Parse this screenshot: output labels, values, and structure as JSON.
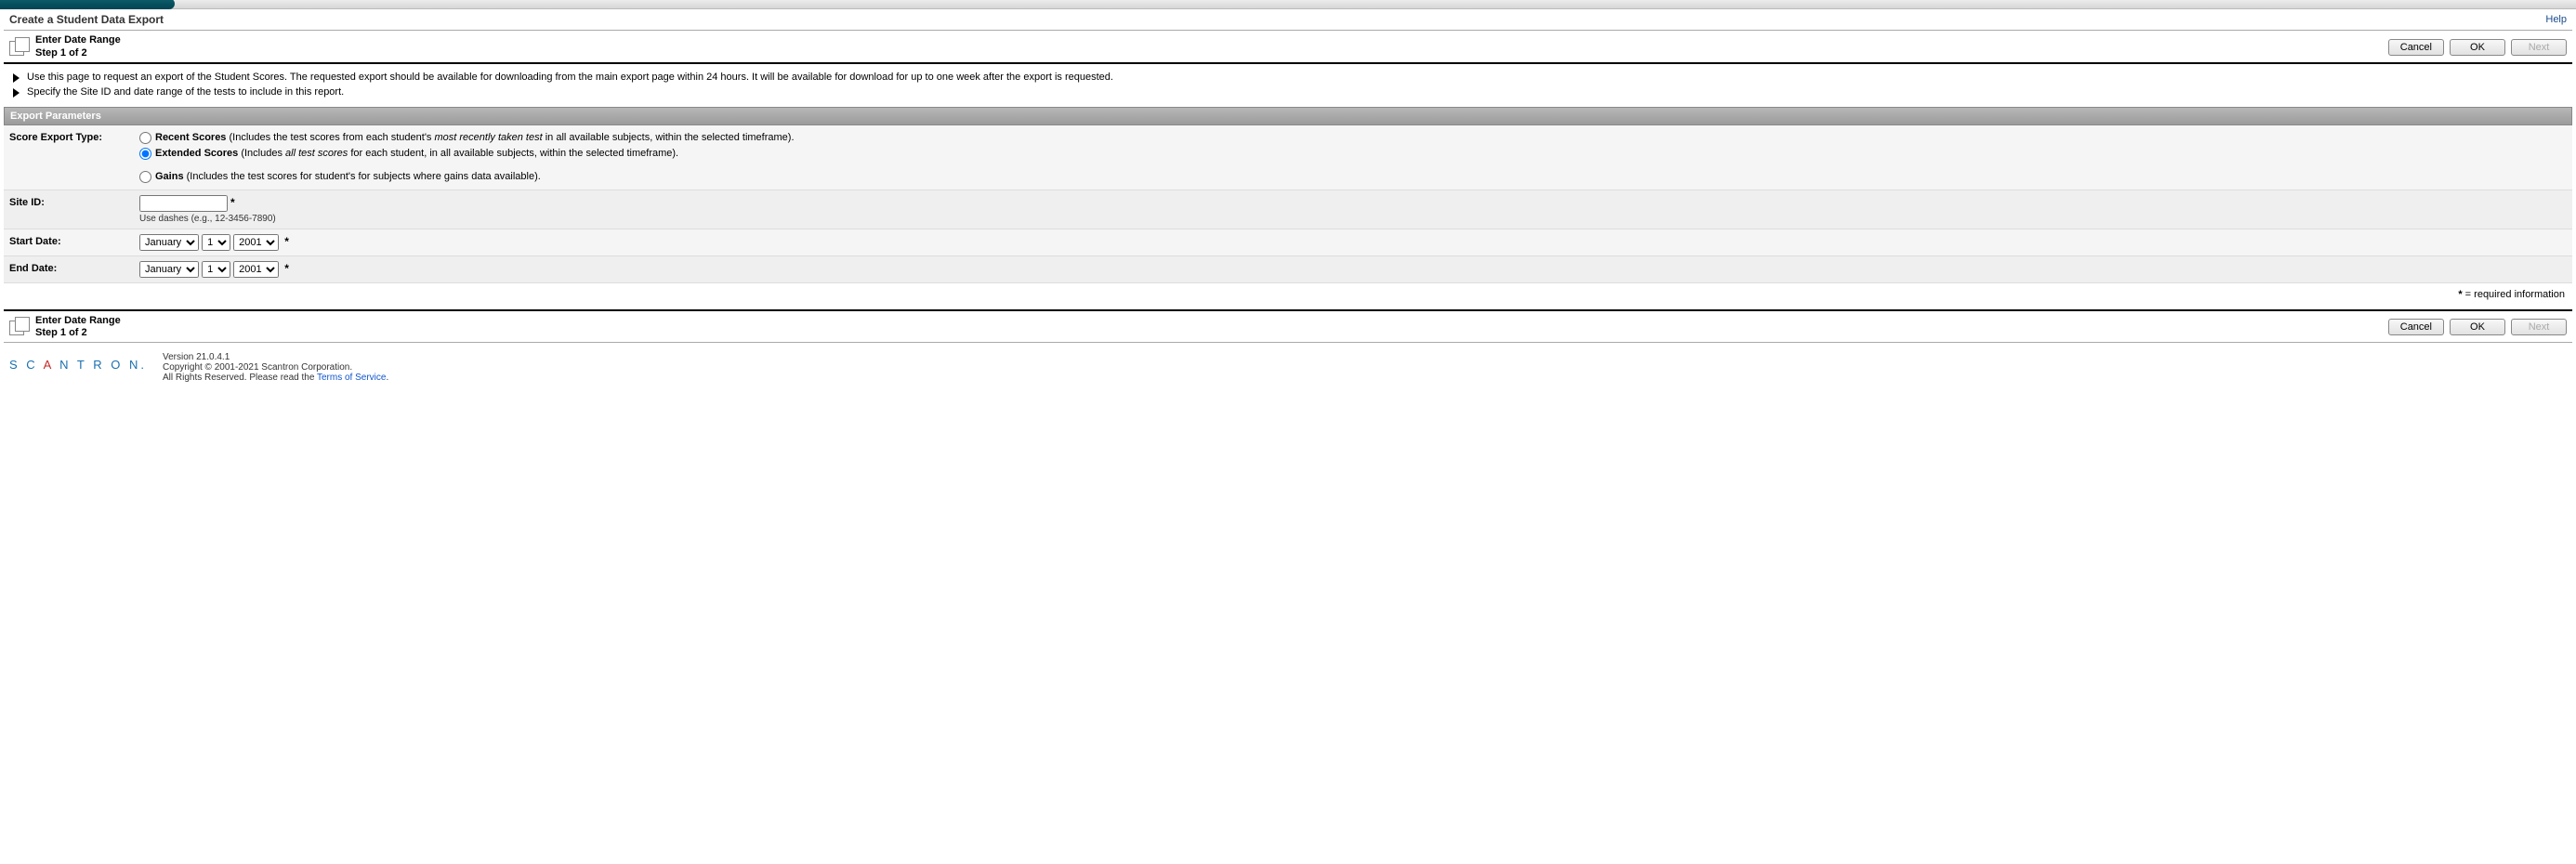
{
  "header": {
    "title": "Create a Student Data Export",
    "help_link": "Help"
  },
  "wizard": {
    "title": "Enter Date Range",
    "step": "Step 1 of 2"
  },
  "buttons": {
    "cancel": "Cancel",
    "ok": "OK",
    "next": "Next"
  },
  "bullets": {
    "line1": "Use this page to request an export of the Student Scores. The requested export should be available for downloading from the main export page within 24 hours. It will be available for download for up to one week after the export is requested.",
    "line2": "Specify the Site ID and date range of the tests to include in this report."
  },
  "section_title": "Export Parameters",
  "fields": {
    "score_type_label": "Score Export Type:",
    "recent_bold": "Recent Scores",
    "recent_open": " (Includes the test scores from each student's ",
    "recent_italic": "most recently taken test",
    "recent_tail": " in all available subjects, within the selected timeframe).",
    "extended_bold": "Extended Scores",
    "extended_open": " (Includes ",
    "extended_italic": "all test scores",
    "extended_tail": " for each student, in all available subjects, within the selected timeframe).",
    "gains_bold": "Gains",
    "gains_tail": " (Includes the test scores for student's for subjects where gains data available).",
    "site_id_label": "Site ID:",
    "site_hint": "Use dashes (e.g., 12-3456-7890)",
    "start_label": "Start Date:",
    "end_label": "End Date:",
    "month_sel": "January",
    "day_sel": "1",
    "year_sel": "2001"
  },
  "required_note_star": "*",
  "required_note_text": " = required information",
  "footer": {
    "version": "Version 21.0.4.1",
    "copyright": "Copyright © 2001-2021 Scantron Corporation.",
    "rights": "All Rights Reserved. Please read the ",
    "tos": "Terms of Service",
    "period": "."
  }
}
